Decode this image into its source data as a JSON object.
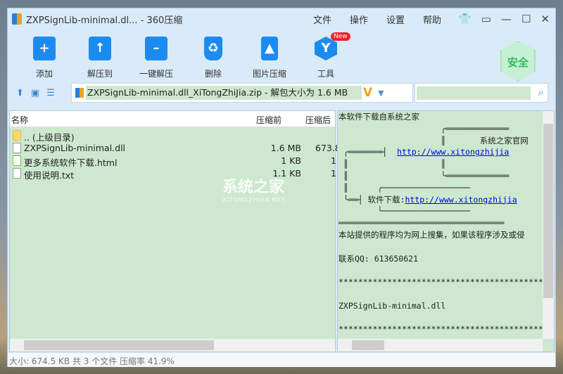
{
  "window": {
    "title": "ZXPSignLib-minimal.dl... - 360压缩"
  },
  "menu": [
    "文件",
    "操作",
    "设置",
    "帮助"
  ],
  "toolbar": [
    {
      "label": "添加",
      "icon": "add-icon"
    },
    {
      "label": "解压到",
      "icon": "extract-to-icon"
    },
    {
      "label": "一键解压",
      "icon": "one-click-extract-icon"
    },
    {
      "label": "删除",
      "icon": "delete-icon"
    },
    {
      "label": "图片压缩",
      "icon": "image-compress-icon"
    },
    {
      "label": "工具",
      "icon": "tools-icon",
      "badge": "New"
    }
  ],
  "security_badge": "安全",
  "address": {
    "path": "ZXPSignLib-minimal.dll_XiTongZhiJia.zip - 解包大小为 1.6 MB",
    "search_value": ""
  },
  "list": {
    "headers": [
      "名称",
      "压缩前",
      "压缩后"
    ],
    "rows": [
      {
        "name": ".. (上级目录)",
        "before": "",
        "after": ""
      },
      {
        "name": "ZXPSignLib-minimal.dll",
        "before": "1.6 MB",
        "after": "673.8"
      },
      {
        "name": "更多系统软件下载.html",
        "before": "1 KB",
        "after": "1"
      },
      {
        "name": "使用说明.txt",
        "before": "1.1 KB",
        "after": "1"
      }
    ]
  },
  "preview": {
    "line1": "本软件下载自系统之家",
    "site_title": "系统之家官网",
    "url1": "http://www.xitongzhijia",
    "download_label": "软件下载:",
    "url2": "http://www.xitongzhijia",
    "notice": "本站提供的程序均为网上搜集，如果该程序涉及或侵",
    "qq": "联系QQ: 613650621",
    "stars": "********************************************",
    "filename": "ZXPSignLib-minimal.dll"
  },
  "status": "大小: 674.5 KB 共 3 个文件 压缩率 41.9%",
  "watermark": {
    "text": "系统之家",
    "sub": "XITONGZHIJIA.NET"
  }
}
